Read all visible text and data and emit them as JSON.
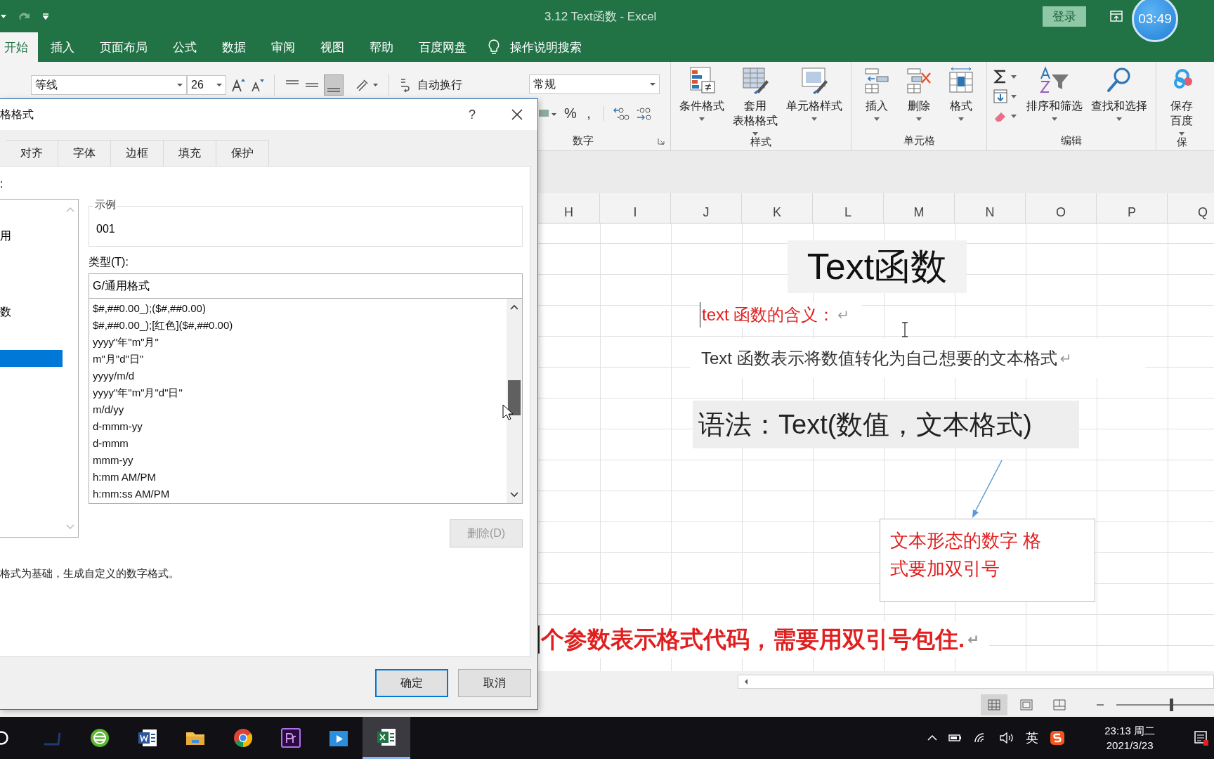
{
  "title_bar": {
    "title": "3.12 Text函数  -  Excel",
    "login": "登录",
    "timer": "03:49"
  },
  "ribbon_tabs": [
    {
      "label": "开始",
      "selected": true
    },
    {
      "label": "插入",
      "selected": false
    },
    {
      "label": "页面布局",
      "selected": false
    },
    {
      "label": "公式",
      "selected": false
    },
    {
      "label": "数据",
      "selected": false
    },
    {
      "label": "审阅",
      "selected": false
    },
    {
      "label": "视图",
      "selected": false
    },
    {
      "label": "帮助",
      "selected": false
    },
    {
      "label": "百度网盘",
      "selected": false
    }
  ],
  "tell_me": "操作说明搜索",
  "ribbon": {
    "font_name": "等线",
    "font_size": "26",
    "wrap_text": "自动换行",
    "number_format": "常规",
    "number_symbols": [
      "%",
      ","
    ],
    "number_group": "数字",
    "groups": [
      {
        "label": "样式",
        "buttons": [
          {
            "kind": "conditional",
            "lines": [
              "条件格式"
            ]
          },
          {
            "kind": "table",
            "lines": [
              "套用",
              "表格格式"
            ]
          },
          {
            "kind": "cellstyle",
            "lines": [
              "单元格样式"
            ]
          }
        ]
      },
      {
        "label": "单元格",
        "buttons": [
          {
            "kind": "insert",
            "lines": [
              "插入"
            ]
          },
          {
            "kind": "delete",
            "lines": [
              "删除"
            ]
          },
          {
            "kind": "format",
            "lines": [
              "格式"
            ]
          }
        ]
      },
      {
        "label": "编辑",
        "tools": [
          {
            "kind": "sum"
          },
          {
            "kind": "fill"
          },
          {
            "kind": "clear"
          }
        ],
        "buttons": [
          {
            "kind": "sort",
            "lines": [
              "排序和筛选"
            ]
          },
          {
            "kind": "find",
            "lines": [
              "查找和选择"
            ]
          }
        ]
      },
      {
        "label": "保",
        "buttons": [
          {
            "kind": "cloud",
            "lines": [
              "保存",
              "百度"
            ]
          }
        ]
      }
    ]
  },
  "dialog": {
    "title": "格格式",
    "help": "?",
    "tabs": [
      {
        "label": "对齐",
        "selected": false
      },
      {
        "label": "字体",
        "selected": false
      },
      {
        "label": "边框",
        "selected": false
      },
      {
        "label": "填充",
        "selected": false
      },
      {
        "label": "保护",
        "selected": false
      }
    ],
    "category_label": ":",
    "categories": [
      {
        "text": "用",
        "selected": false
      },
      {
        "text": "数",
        "selected": false
      },
      {
        "selected": true
      }
    ],
    "sample_label": "示例",
    "sample_value": "001",
    "type_label": "类型(T):",
    "type_value": "G/通用格式",
    "formats": [
      "$#,##0.00_);($#,##0.00)",
      "$#,##0.00_);[红色]($#,##0.00)",
      "yyyy\"年\"m\"月\"",
      "m\"月\"d\"日\"",
      "yyyy/m/d",
      "yyyy\"年\"m\"月\"d\"日\"",
      "m/d/yy",
      "d-mmm-yy",
      "d-mmm",
      "mmm-yy",
      "h:mm AM/PM",
      "h:mm:ss AM/PM"
    ],
    "delete_button": {
      "label": "删除(D)",
      "disabled": true
    },
    "description": "格式为基础，生成自定义的数字格式。",
    "ok": "确定",
    "cancel": "取消"
  },
  "sheet": {
    "columns": [
      "H",
      "I",
      "J",
      "K",
      "L",
      "M",
      "N",
      "O",
      "P",
      "Q"
    ],
    "title": "Text函数",
    "meaning": {
      "text": "text 函数的含义：",
      "mark": "↵"
    },
    "definition": {
      "text": "Text 函数表示将数值转化为自己想要的文本格式",
      "mark": "↵"
    },
    "syntax": "语法：Text(数值，文本格式)",
    "callout": "文本形态的数字 格式要加双引号",
    "note": {
      "text": "个参数表示格式代码，需要用双引号包住.",
      "mark": "↵"
    }
  },
  "status_bar": {
    "views": [
      {
        "kind": "normal",
        "selected": true
      },
      {
        "kind": "layout",
        "selected": false
      },
      {
        "kind": "pagebreak",
        "selected": false
      }
    ],
    "zoom": {
      "level": 0.55
    }
  },
  "taskbar": {
    "apps": [
      {
        "kind": "search",
        "selected": false
      },
      {
        "kind": "dark",
        "selected": false
      },
      {
        "kind": "browser",
        "selected": false
      },
      {
        "kind": "word",
        "selected": false
      },
      {
        "kind": "folder",
        "selected": false
      },
      {
        "kind": "chrome",
        "selected": false
      },
      {
        "kind": "premiere",
        "selected": false
      },
      {
        "kind": "video",
        "selected": false
      },
      {
        "kind": "excel",
        "selected": true
      }
    ],
    "ime": "英",
    "time": "23:13 周二",
    "date": "2021/3/23"
  }
}
